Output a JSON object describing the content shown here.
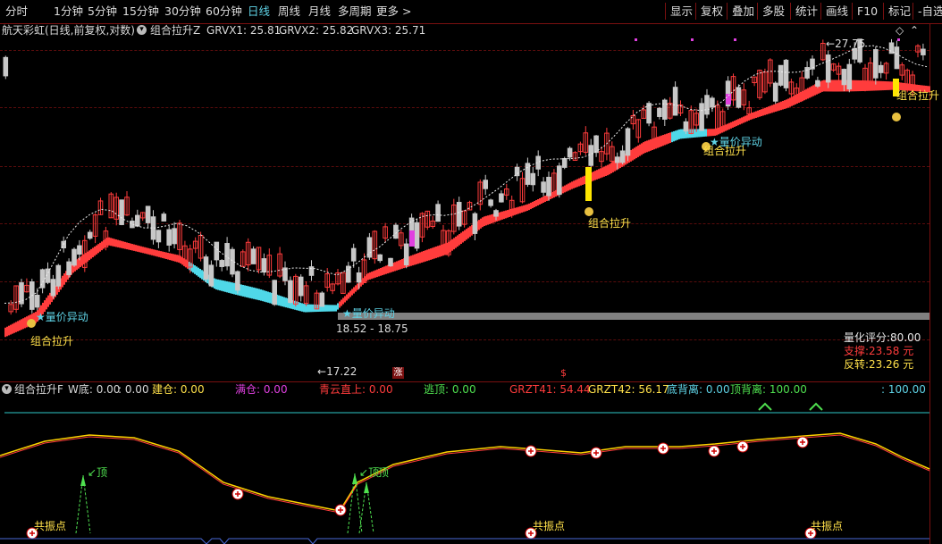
{
  "toolbar": {
    "periods": [
      "分时",
      "1分钟",
      "5分钟",
      "15分钟",
      "30分钟",
      "60分钟",
      "日线",
      "周线",
      "月线",
      "多周期",
      "更多 >"
    ],
    "active_period": "日线",
    "right_buttons": [
      "显示",
      "复权",
      "叠加",
      "多股",
      "统计",
      "画线",
      "F10",
      "标记",
      "-自选"
    ]
  },
  "main": {
    "stock_title": "航天彩虹(日线,前复权,对数)",
    "indicator_name": "组合拉升Z",
    "grvx1": "GRVX1: 25.81",
    "grvx2": "GRVX2: 25.82",
    "grvx3": "GRVX3: 25.71",
    "labels": {
      "high_price": "27.75",
      "low_price": "17.22",
      "range_text": "18.52 - 18.75",
      "vol_price_1": "量价异动",
      "vol_price_2": "量价异动",
      "vol_price_3": "量价异动",
      "combo_1": "组合拉升",
      "combo_2": "组合拉升",
      "combo_3": "组合拉升",
      "combo_4": "组合拉升",
      "zhang_badge": "涨",
      "dollar_badge": "$"
    },
    "score_panel": {
      "score": "量化评分:80.00",
      "support": "支撑:23.58 元",
      "reversal": "反转:23.26 元"
    },
    "colors": {
      "up": "#ff3c3c",
      "down": "#c8c8c8",
      "band_red": "#ff3c3c",
      "band_cyan": "#4fd8e8",
      "gray_line": "#808080"
    }
  },
  "sub": {
    "indicator_name": "组合拉升F",
    "w_bottom": "W底: 0.00",
    "w_bottom_2": ": 0.00",
    "build": "建仓: 0.00",
    "full": "满仓: 0.00",
    "qingyun": "青云直上: 0.00",
    "escape": "逃顶: 0.00",
    "grzt41": "GRZT41: 54.44",
    "grzt42": "GRZT42: 56.17",
    "bottom_div": "底背离: 0.00",
    "top_div": "顶背离: 100.00",
    "last_val": ": 100.00",
    "labels": {
      "top1": "顶",
      "top2": "顶",
      "top3": "顶",
      "resonance_1": "共振点",
      "resonance_2": "共振点",
      "resonance_3": "共振点"
    }
  }
}
